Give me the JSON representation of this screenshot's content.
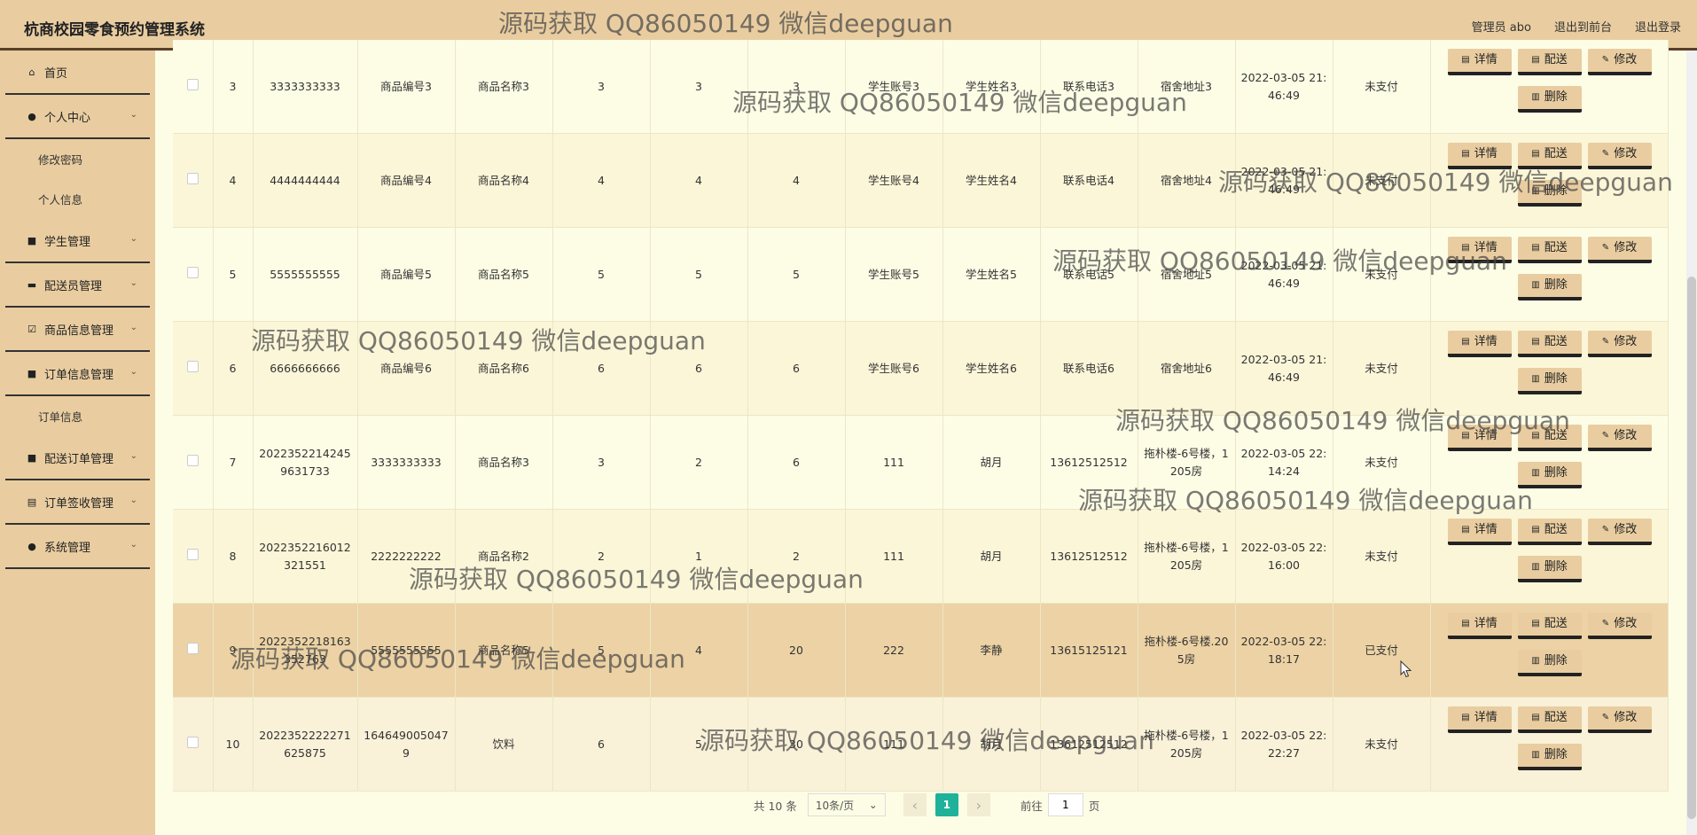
{
  "header": {
    "title": "杭商校园零食预约管理系统",
    "user_label": "管理员 abo",
    "front_label": "退出到前台",
    "logout_label": "退出登录"
  },
  "sidebar": {
    "items": [
      {
        "label": "首页",
        "icon": "home-icon",
        "expandable": false
      },
      {
        "label": "个人中心",
        "icon": "user-icon",
        "expandable": true
      },
      {
        "label": "修改密码",
        "sub": true
      },
      {
        "label": "个人信息",
        "sub": true
      },
      {
        "label": "学生管理",
        "icon": "grid-icon",
        "expandable": true
      },
      {
        "label": "配送员管理",
        "icon": "monitor-icon",
        "expandable": true
      },
      {
        "label": "商品信息管理",
        "icon": "check-square-icon",
        "expandable": true
      },
      {
        "label": "订单信息管理",
        "icon": "grid-icon",
        "expandable": true
      },
      {
        "label": "订单信息",
        "sub": true
      },
      {
        "label": "配送订单管理",
        "icon": "grid-icon",
        "expandable": true
      },
      {
        "label": "订单签收管理",
        "icon": "receipt-icon",
        "expandable": true
      },
      {
        "label": "系统管理",
        "icon": "user-icon",
        "expandable": true
      }
    ]
  },
  "buttons": {
    "detail": "详情",
    "deliver": "配送",
    "edit": "修改",
    "delete": "删除"
  },
  "rows": [
    {
      "idx": "3",
      "order": "3333333333",
      "code": "商品编号3",
      "name": "商品名称3",
      "c5": "3",
      "c6": "3",
      "c7": "3",
      "account": "学生账号3",
      "student": "学生姓名3",
      "phone": "联系电话3",
      "address": "宿舍地址3",
      "time": "2022-03-05 21:46:49",
      "status": "未支付"
    },
    {
      "idx": "4",
      "order": "4444444444",
      "code": "商品编号4",
      "name": "商品名称4",
      "c5": "4",
      "c6": "4",
      "c7": "4",
      "account": "学生账号4",
      "student": "学生姓名4",
      "phone": "联系电话4",
      "address": "宿舍地址4",
      "time": "2022-03-05 21:46:49",
      "status": "未支付"
    },
    {
      "idx": "5",
      "order": "5555555555",
      "code": "商品编号5",
      "name": "商品名称5",
      "c5": "5",
      "c6": "5",
      "c7": "5",
      "account": "学生账号5",
      "student": "学生姓名5",
      "phone": "联系电话5",
      "address": "宿舍地址5",
      "time": "2022-03-05 21:46:49",
      "status": "未支付"
    },
    {
      "idx": "6",
      "order": "6666666666",
      "code": "商品编号6",
      "name": "商品名称6",
      "c5": "6",
      "c6": "6",
      "c7": "6",
      "account": "学生账号6",
      "student": "学生姓名6",
      "phone": "联系电话6",
      "address": "宿舍地址6",
      "time": "2022-03-05 21:46:49",
      "status": "未支付"
    },
    {
      "idx": "7",
      "order": "20223522142459631733",
      "code": "3333333333",
      "name": "商品名称3",
      "c5": "3",
      "c6": "2",
      "c7": "6",
      "account": "111",
      "student": "胡月",
      "phone": "13612512512",
      "address": "拖朴楼-6号楼，1205房",
      "time": "2022-03-05 22:14:24",
      "status": "未支付"
    },
    {
      "idx": "8",
      "order": "20223522160123215​51",
      "code": "2222222222",
      "name": "商品名称2",
      "c5": "2",
      "c6": "1",
      "c7": "2",
      "account": "111",
      "student": "胡月",
      "phone": "13612512512",
      "address": "拖朴楼-6号楼，1205房",
      "time": "2022-03-05 22:16:00",
      "status": "未支付"
    },
    {
      "idx": "9",
      "order": "20223522181633527​63",
      "code": "5555555555",
      "name": "商品名称5",
      "c5": "5",
      "c6": "4",
      "c7": "20",
      "account": "222",
      "student": "李静",
      "phone": "13615125121",
      "address": "拖朴楼-6号楼.205房",
      "time": "2022-03-05 22:18:17",
      "status": "已支付"
    },
    {
      "idx": "10",
      "order": "20223522222716258​75",
      "code": "1646490050479",
      "name": "饮料",
      "c5": "6",
      "c6": "5",
      "c7": "30",
      "account": "111",
      "student": "胡月",
      "phone": "13612512512",
      "address": "拖朴楼-6号楼，1205房",
      "time": "2022-03-05 22:22:27",
      "status": "未支付"
    }
  ],
  "pagination": {
    "total": "共 10 条",
    "page_size": "10条/页",
    "current": "1",
    "goto_label": "前往",
    "goto_value": "1",
    "page_unit": "页"
  },
  "watermark": "源码获取 QQ86050149 微信deepguan"
}
